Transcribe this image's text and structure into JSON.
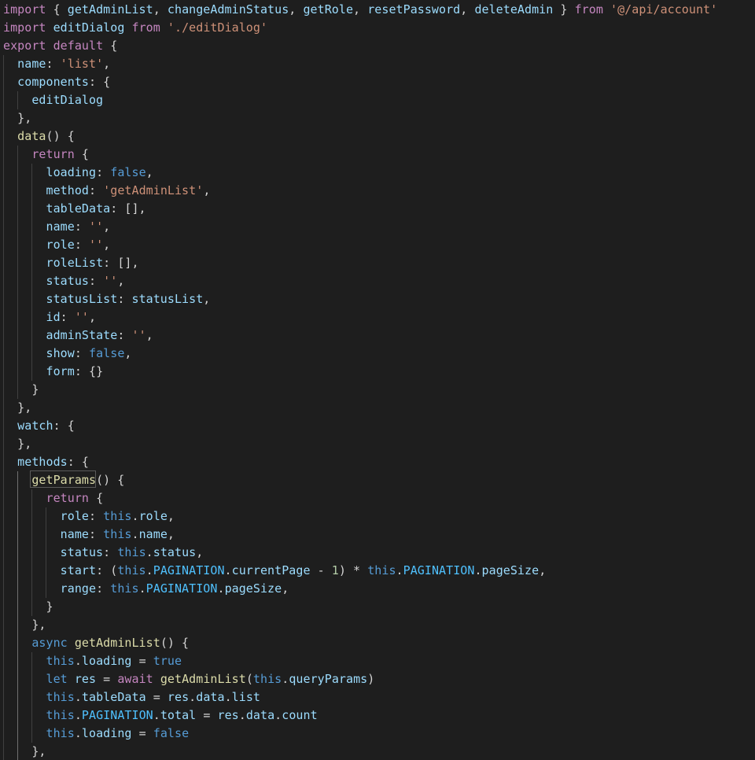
{
  "editor": {
    "lines": [
      [
        [
          "import",
          "keyword"
        ],
        [
          " { ",
          "punct"
        ],
        [
          "getAdminList",
          "var"
        ],
        [
          ", ",
          "punct"
        ],
        [
          "changeAdminStatus",
          "var"
        ],
        [
          ", ",
          "punct"
        ],
        [
          "getRole",
          "var"
        ],
        [
          ", ",
          "punct"
        ],
        [
          "resetPassword",
          "var"
        ],
        [
          ", ",
          "punct"
        ],
        [
          "deleteAdmin",
          "var"
        ],
        [
          " } ",
          "punct"
        ],
        [
          "from",
          "keyword"
        ],
        [
          " ",
          "plain"
        ],
        [
          "'@/api/account'",
          "string"
        ]
      ],
      [
        [
          "import",
          "keyword"
        ],
        [
          " ",
          "plain"
        ],
        [
          "editDialog",
          "var"
        ],
        [
          " ",
          "plain"
        ],
        [
          "from",
          "keyword"
        ],
        [
          " ",
          "plain"
        ],
        [
          "'./editDialog'",
          "string"
        ]
      ],
      [
        [
          "export",
          "keyword"
        ],
        [
          " ",
          "plain"
        ],
        [
          "default",
          "keyword"
        ],
        [
          " {",
          "punct"
        ]
      ],
      [
        [
          "  ",
          "plain"
        ],
        [
          "name",
          "prop"
        ],
        [
          ": ",
          "punct"
        ],
        [
          "'list'",
          "string"
        ],
        [
          ",",
          "punct"
        ]
      ],
      [
        [
          "  ",
          "plain"
        ],
        [
          "components",
          "prop"
        ],
        [
          ": {",
          "punct"
        ]
      ],
      [
        [
          "    ",
          "plain"
        ],
        [
          "editDialog",
          "var"
        ]
      ],
      [
        [
          "  ",
          "plain"
        ],
        [
          "},",
          "punct"
        ]
      ],
      [
        [
          "  ",
          "plain"
        ],
        [
          "data",
          "func"
        ],
        [
          "() {",
          "punct"
        ]
      ],
      [
        [
          "    ",
          "plain"
        ],
        [
          "return",
          "keyword"
        ],
        [
          " {",
          "punct"
        ]
      ],
      [
        [
          "      ",
          "plain"
        ],
        [
          "loading",
          "prop"
        ],
        [
          ": ",
          "punct"
        ],
        [
          "false",
          "bool"
        ],
        [
          ",",
          "punct"
        ]
      ],
      [
        [
          "      ",
          "plain"
        ],
        [
          "method",
          "prop"
        ],
        [
          ": ",
          "punct"
        ],
        [
          "'getAdminList'",
          "string"
        ],
        [
          ",",
          "punct"
        ]
      ],
      [
        [
          "      ",
          "plain"
        ],
        [
          "tableData",
          "prop"
        ],
        [
          ": [],",
          "punct"
        ]
      ],
      [
        [
          "      ",
          "plain"
        ],
        [
          "name",
          "prop"
        ],
        [
          ": ",
          "punct"
        ],
        [
          "''",
          "string"
        ],
        [
          ",",
          "punct"
        ]
      ],
      [
        [
          "      ",
          "plain"
        ],
        [
          "role",
          "prop"
        ],
        [
          ": ",
          "punct"
        ],
        [
          "''",
          "string"
        ],
        [
          ",",
          "punct"
        ]
      ],
      [
        [
          "      ",
          "plain"
        ],
        [
          "roleList",
          "prop"
        ],
        [
          ": [],",
          "punct"
        ]
      ],
      [
        [
          "      ",
          "plain"
        ],
        [
          "status",
          "prop"
        ],
        [
          ": ",
          "punct"
        ],
        [
          "''",
          "string"
        ],
        [
          ",",
          "punct"
        ]
      ],
      [
        [
          "      ",
          "plain"
        ],
        [
          "statusList",
          "prop"
        ],
        [
          ": ",
          "punct"
        ],
        [
          "statusList",
          "var"
        ],
        [
          ",",
          "punct"
        ]
      ],
      [
        [
          "      ",
          "plain"
        ],
        [
          "id",
          "prop"
        ],
        [
          ": ",
          "punct"
        ],
        [
          "''",
          "string"
        ],
        [
          ",",
          "punct"
        ]
      ],
      [
        [
          "      ",
          "plain"
        ],
        [
          "adminState",
          "prop"
        ],
        [
          ": ",
          "punct"
        ],
        [
          "''",
          "string"
        ],
        [
          ",",
          "punct"
        ]
      ],
      [
        [
          "      ",
          "plain"
        ],
        [
          "show",
          "prop"
        ],
        [
          ": ",
          "punct"
        ],
        [
          "false",
          "bool"
        ],
        [
          ",",
          "punct"
        ]
      ],
      [
        [
          "      ",
          "plain"
        ],
        [
          "form",
          "prop"
        ],
        [
          ": {}",
          "punct"
        ]
      ],
      [
        [
          "    ",
          "plain"
        ],
        [
          "}",
          "punct"
        ]
      ],
      [
        [
          "  ",
          "plain"
        ],
        [
          "},",
          "punct"
        ]
      ],
      [
        [
          "  ",
          "plain"
        ],
        [
          "watch",
          "prop"
        ],
        [
          ": {",
          "punct"
        ]
      ],
      [
        [
          "  ",
          "plain"
        ],
        [
          "},",
          "punct"
        ]
      ],
      [
        [
          "  ",
          "plain"
        ],
        [
          "methods",
          "prop"
        ],
        [
          ": {",
          "punct"
        ]
      ],
      [
        [
          "    ",
          "plain"
        ],
        [
          "getParams",
          "func"
        ],
        [
          "() {",
          "punct"
        ]
      ],
      [
        [
          "      ",
          "plain"
        ],
        [
          "return",
          "keyword"
        ],
        [
          " {",
          "punct"
        ]
      ],
      [
        [
          "        ",
          "plain"
        ],
        [
          "role",
          "prop"
        ],
        [
          ": ",
          "punct"
        ],
        [
          "this",
          "storage"
        ],
        [
          ".",
          "punct"
        ],
        [
          "role",
          "prop"
        ],
        [
          ",",
          "punct"
        ]
      ],
      [
        [
          "        ",
          "plain"
        ],
        [
          "name",
          "prop"
        ],
        [
          ": ",
          "punct"
        ],
        [
          "this",
          "storage"
        ],
        [
          ".",
          "punct"
        ],
        [
          "name",
          "prop"
        ],
        [
          ",",
          "punct"
        ]
      ],
      [
        [
          "        ",
          "plain"
        ],
        [
          "status",
          "prop"
        ],
        [
          ": ",
          "punct"
        ],
        [
          "this",
          "storage"
        ],
        [
          ".",
          "punct"
        ],
        [
          "status",
          "prop"
        ],
        [
          ",",
          "punct"
        ]
      ],
      [
        [
          "        ",
          "plain"
        ],
        [
          "start",
          "prop"
        ],
        [
          ": (",
          "punct"
        ],
        [
          "this",
          "storage"
        ],
        [
          ".",
          "punct"
        ],
        [
          "PAGINATION",
          "const"
        ],
        [
          ".",
          "punct"
        ],
        [
          "currentPage",
          "prop"
        ],
        [
          " - ",
          "op"
        ],
        [
          "1",
          "num"
        ],
        [
          ") * ",
          "op"
        ],
        [
          "this",
          "storage"
        ],
        [
          ".",
          "punct"
        ],
        [
          "PAGINATION",
          "const"
        ],
        [
          ".",
          "punct"
        ],
        [
          "pageSize",
          "prop"
        ],
        [
          ",",
          "punct"
        ]
      ],
      [
        [
          "        ",
          "plain"
        ],
        [
          "range",
          "prop"
        ],
        [
          ": ",
          "punct"
        ],
        [
          "this",
          "storage"
        ],
        [
          ".",
          "punct"
        ],
        [
          "PAGINATION",
          "const"
        ],
        [
          ".",
          "punct"
        ],
        [
          "pageSize",
          "prop"
        ],
        [
          ",",
          "punct"
        ]
      ],
      [
        [
          "      ",
          "plain"
        ],
        [
          "}",
          "punct"
        ]
      ],
      [
        [
          "    ",
          "plain"
        ],
        [
          "},",
          "punct"
        ]
      ],
      [
        [
          "    ",
          "plain"
        ],
        [
          "async",
          "storage"
        ],
        [
          " ",
          "plain"
        ],
        [
          "getAdminList",
          "func"
        ],
        [
          "() {",
          "punct"
        ]
      ],
      [
        [
          "      ",
          "plain"
        ],
        [
          "this",
          "storage"
        ],
        [
          ".",
          "punct"
        ],
        [
          "loading",
          "prop"
        ],
        [
          " = ",
          "op"
        ],
        [
          "true",
          "bool"
        ]
      ],
      [
        [
          "      ",
          "plain"
        ],
        [
          "let",
          "storage"
        ],
        [
          " ",
          "plain"
        ],
        [
          "res",
          "var"
        ],
        [
          " = ",
          "op"
        ],
        [
          "await",
          "keyword"
        ],
        [
          " ",
          "plain"
        ],
        [
          "getAdminList",
          "func"
        ],
        [
          "(",
          "punct"
        ],
        [
          "this",
          "storage"
        ],
        [
          ".",
          "punct"
        ],
        [
          "queryParams",
          "prop"
        ],
        [
          ")",
          "punct"
        ]
      ],
      [
        [
          "      ",
          "plain"
        ],
        [
          "this",
          "storage"
        ],
        [
          ".",
          "punct"
        ],
        [
          "tableData",
          "prop"
        ],
        [
          " = ",
          "op"
        ],
        [
          "res",
          "var"
        ],
        [
          ".",
          "punct"
        ],
        [
          "data",
          "prop"
        ],
        [
          ".",
          "punct"
        ],
        [
          "list",
          "prop"
        ]
      ],
      [
        [
          "      ",
          "plain"
        ],
        [
          "this",
          "storage"
        ],
        [
          ".",
          "punct"
        ],
        [
          "PAGINATION",
          "const"
        ],
        [
          ".",
          "punct"
        ],
        [
          "total",
          "prop"
        ],
        [
          " = ",
          "op"
        ],
        [
          "res",
          "var"
        ],
        [
          ".",
          "punct"
        ],
        [
          "data",
          "prop"
        ],
        [
          ".",
          "punct"
        ],
        [
          "count",
          "prop"
        ]
      ],
      [
        [
          "      ",
          "plain"
        ],
        [
          "this",
          "storage"
        ],
        [
          ".",
          "punct"
        ],
        [
          "loading",
          "prop"
        ],
        [
          " = ",
          "op"
        ],
        [
          "false",
          "bool"
        ]
      ],
      [
        [
          "    ",
          "plain"
        ],
        [
          "},",
          "punct"
        ]
      ]
    ]
  }
}
